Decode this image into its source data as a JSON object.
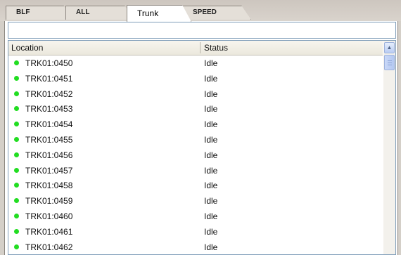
{
  "tabs": [
    {
      "label": "BLF",
      "active": false
    },
    {
      "label": "ALL",
      "active": false
    },
    {
      "label": "Trunk",
      "active": true
    },
    {
      "label": "SPEED",
      "active": false
    }
  ],
  "filter": {
    "value": ""
  },
  "list": {
    "columns": [
      "Location",
      "Status"
    ],
    "status_color": "#22dd22",
    "rows": [
      {
        "location": "TRK01:0450",
        "status": "Idle"
      },
      {
        "location": "TRK01:0451",
        "status": "Idle"
      },
      {
        "location": "TRK01:0452",
        "status": "Idle"
      },
      {
        "location": "TRK01:0453",
        "status": "Idle"
      },
      {
        "location": "TRK01:0454",
        "status": "Idle"
      },
      {
        "location": "TRK01:0455",
        "status": "Idle"
      },
      {
        "location": "TRK01:0456",
        "status": "Idle"
      },
      {
        "location": "TRK01:0457",
        "status": "Idle"
      },
      {
        "location": "TRK01:0458",
        "status": "Idle"
      },
      {
        "location": "TRK01:0459",
        "status": "Idle"
      },
      {
        "location": "TRK01:0460",
        "status": "Idle"
      },
      {
        "location": "TRK01:0461",
        "status": "Idle"
      },
      {
        "location": "TRK01:0462",
        "status": "Idle"
      }
    ]
  },
  "scrollbar": {
    "up_icon": "chevron-up-icon"
  }
}
